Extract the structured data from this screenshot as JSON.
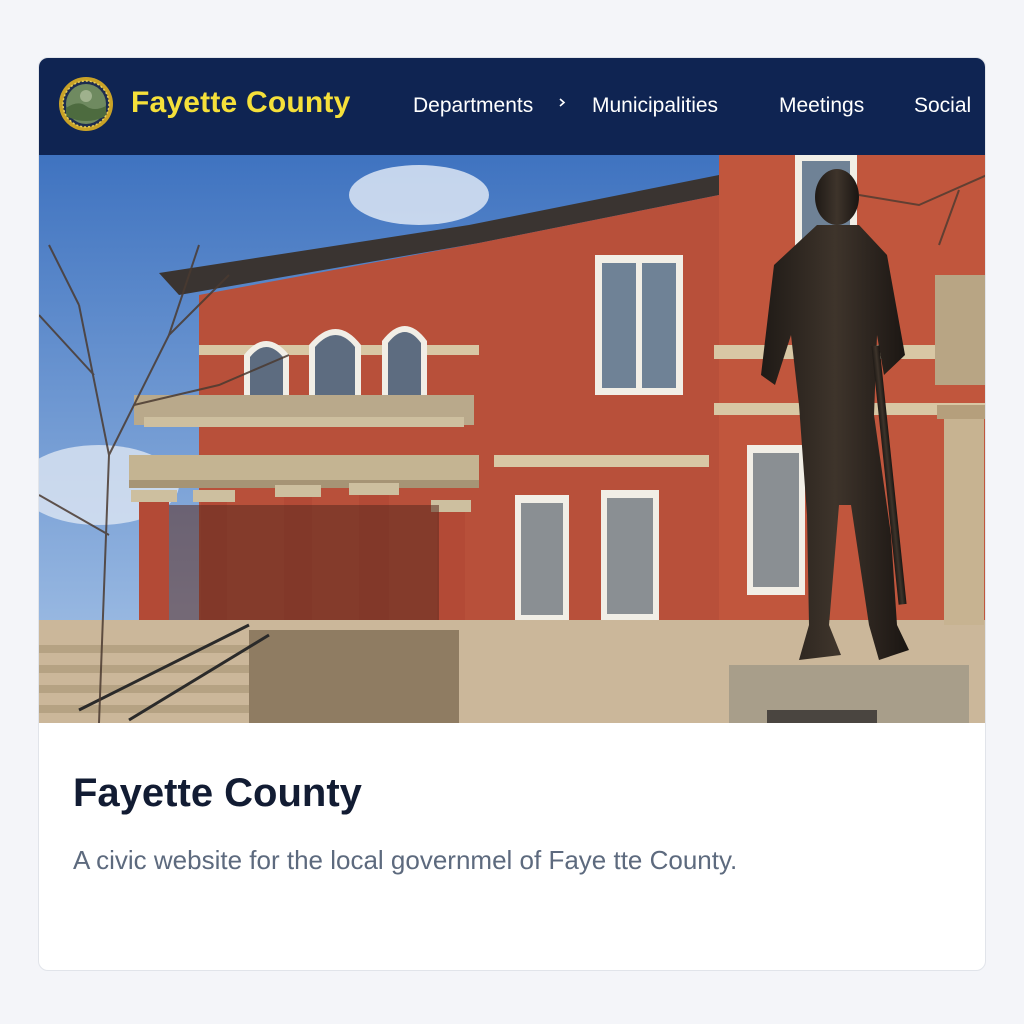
{
  "site": {
    "name": "Fayette County",
    "seal": {
      "text": "SEAL OF FAYETTE COUNTY"
    }
  },
  "nav": {
    "items": [
      {
        "label": "Departments",
        "has_dropdown": true
      },
      {
        "label": "Municipalities",
        "has_dropdown": false
      },
      {
        "label": "Meetings",
        "has_dropdown": false
      },
      {
        "label": "Social",
        "has_dropdown": false
      }
    ]
  },
  "hero": {
    "subject": "Red brick county courthouse with columned porch and bronze statue of a soldier"
  },
  "content": {
    "title": "Fayette County",
    "description": "A civic website for the local governmel of Faye tte County."
  },
  "colors": {
    "navbar": "#0f2452",
    "brand": "#f5e03a",
    "title": "#121c33",
    "description": "#5d6a7e"
  }
}
